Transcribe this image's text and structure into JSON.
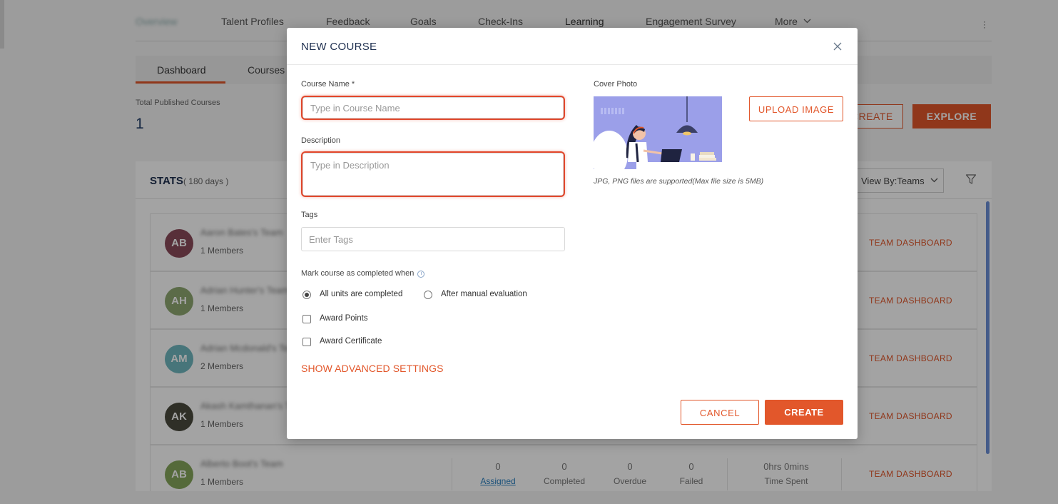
{
  "topnav": {
    "items": [
      "Overview",
      "Talent Profiles",
      "Feedback",
      "Goals",
      "Check-Ins",
      "Learning",
      "Engagement Survey",
      "More"
    ],
    "active": "Learning"
  },
  "subtabs": {
    "items": [
      "Dashboard",
      "Courses"
    ],
    "active": "Dashboard"
  },
  "summary": {
    "label": "Total Published Courses",
    "value": "1"
  },
  "page_actions": {
    "create": "CREATE",
    "explore": "EXPLORE"
  },
  "stats": {
    "title": "STATS",
    "period": "( 180 days )",
    "view_by": "View By:Teams",
    "team_dashboard_label": "TEAM DASHBOARD",
    "teams": [
      {
        "initials": "AB",
        "color": "#8a4a5a",
        "name": "Aaron Bates's Team",
        "members": "1 Members"
      },
      {
        "initials": "AH",
        "color": "#8fa871",
        "name": "Adrian Hunter's Team",
        "members": "1 Members"
      },
      {
        "initials": "AM",
        "color": "#6fb7bf",
        "name": "Adrian Mcdonald's Team",
        "members": "2 Members"
      },
      {
        "initials": "AK",
        "color": "#4a4a3e",
        "name": "Akash Kamthanan's Team",
        "members": "1 Members"
      },
      {
        "initials": "AB",
        "color": "#86a65c",
        "name": "Alberto Boot's Team",
        "members": "1 Members"
      }
    ],
    "metrics": {
      "assigned": "0",
      "assigned_label": "Assigned",
      "completed": "0",
      "completed_label": "Completed",
      "overdue": "0",
      "overdue_label": "Overdue",
      "failed": "0",
      "failed_label": "Failed",
      "time_spent": "0hrs 0mins",
      "time_spent_label": "Time Spent"
    }
  },
  "modal": {
    "title": "NEW COURSE",
    "course_name_label": "Course Name *",
    "course_name_placeholder": "Type in Course Name",
    "course_name_value": "",
    "description_label": "Description",
    "description_placeholder": "Type in Description",
    "description_value": "",
    "tags_label": "Tags",
    "tags_placeholder": "Enter Tags",
    "completion_label": "Mark course as completed when",
    "completion_options": [
      "All units are completed",
      "After manual evaluation"
    ],
    "completion_selected": "All units are completed",
    "award_points_label": "Award Points",
    "award_points_checked": false,
    "award_certificate_label": "Award Certificate",
    "award_certificate_checked": false,
    "advanced_link": "SHOW ADVANCED SETTINGS",
    "cover_photo_label": "Cover Photo",
    "upload_button": "UPLOAD IMAGE",
    "file_hint": "JPG, PNG files are supported(Max file size is 5MB)",
    "cancel_button": "CANCEL",
    "create_button": "CREATE"
  },
  "colors": {
    "accent": "#e2572b",
    "highlight": "#e2472b",
    "title": "#1e2f4f"
  }
}
